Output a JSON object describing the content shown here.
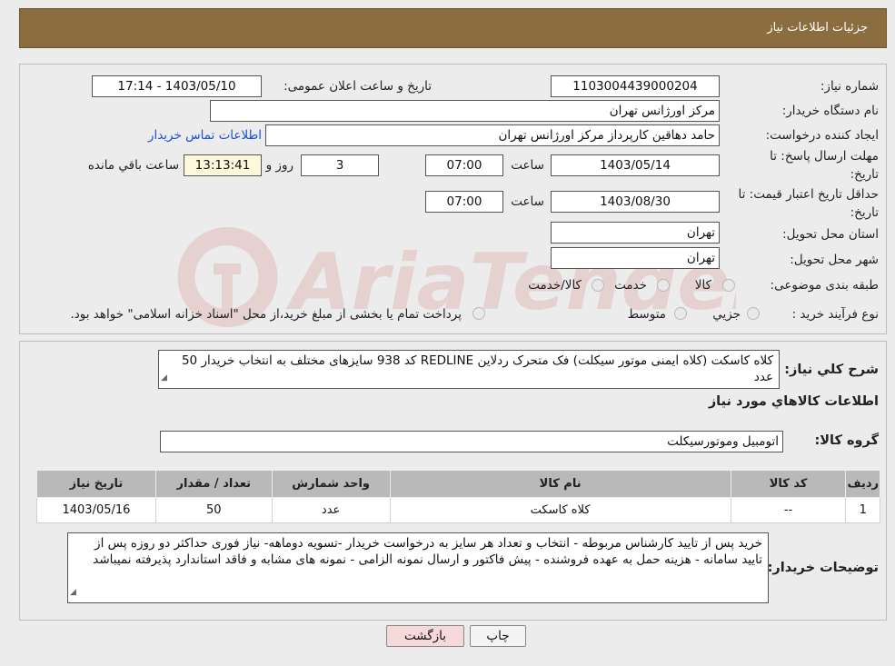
{
  "header": {
    "title": "جزئیات اطلاعات نیاز"
  },
  "labels": {
    "need_number": "شماره نیاز:",
    "announce_datetime": "تاریخ و ساعت اعلان عمومی:",
    "buyer_org": "نام دستگاه خریدار:",
    "requester": "ایجاد کننده درخواست:",
    "reply_deadline_line1": "مهلت ارسال پاسخ: تا",
    "reply_deadline_line2": "تاریخ:",
    "hour": "ساعت",
    "day_and": "روز و",
    "remaining": "ساعت باقي مانده",
    "price_validity_line1": "حداقل تاریخ اعتبار قیمت: تا",
    "price_validity_line2": "تاریخ:",
    "province": "استان محل تحویل:",
    "city": "شهر محل تحویل:",
    "category": "طبقه بندی موضوعی:",
    "process_type": "نوع فرآیند خرید :",
    "general_desc": "شرح کلي نياز:",
    "goods_info": "اطلاعات کالاهاي مورد نياز",
    "goods_group": "گروه کالا:",
    "buyer_notes": "توضیحات خریدار:"
  },
  "fields": {
    "need_number": "1103004439000204",
    "announce_datetime": "1403/05/10 - 17:14",
    "buyer_org": "مرکز اورژانس تهران",
    "requester": "حامد دهاقین کارپرداز مرکز اورژانس تهران",
    "contact_link": "اطلاعات تماس خریدار",
    "reply_date": "1403/05/14",
    "reply_hour": "07:00",
    "days_left": "3",
    "time_left": "13:13:41",
    "validity_date": "1403/08/30",
    "validity_hour": "07:00",
    "province": "تهران",
    "city": "تهران",
    "general_desc": "کلاه کاسکت (کلاه ایمنی موتور سیکلت) فک متحرک ردلاین REDLINE کد 938 سایزهای مختلف به انتخاب خریدار 50 عدد",
    "goods_group": "اتومبیل وموتورسیکلت",
    "buyer_notes": "خرید پس از تایید کارشناس مربوطه - انتخاب و تعداد هر سایز به درخواست خریدار -تسویه دوماهه- نیاز فوری حداکثر دو روزه پس از تایید سامانه - هزینه حمل به عهده فروشنده - پیش فاکتور و ارسال نمونه الزامی - نمونه های مشابه و فاقد استاندارد پذیرفته نمیباشد"
  },
  "category_options": [
    "کالا",
    "خدمت",
    "کالا/خدمت"
  ],
  "process_options": [
    "جزيي",
    "متوسط",
    "پرداخت تمام یا بخشی از مبلغ خرید،از محل \"اسناد خزانه اسلامی\" خواهد بود."
  ],
  "table": {
    "headers": [
      "ردیف",
      "کد کالا",
      "نام کالا",
      "واحد شمارش",
      "تعداد / مقدار",
      "تاریخ نیاز"
    ],
    "rows": [
      [
        "1",
        "--",
        "کلاه کاسکت",
        "عدد",
        "50",
        "1403/05/16"
      ]
    ]
  },
  "buttons": {
    "print": "چاپ",
    "back": "بازگشت"
  },
  "watermark_text": "AriaTender.neT",
  "colors": {
    "header_bg": "#8b6d3f",
    "link": "#1a4fd6",
    "back_button": "#f6d9d9",
    "timer_bg": "#fcf8dc"
  }
}
